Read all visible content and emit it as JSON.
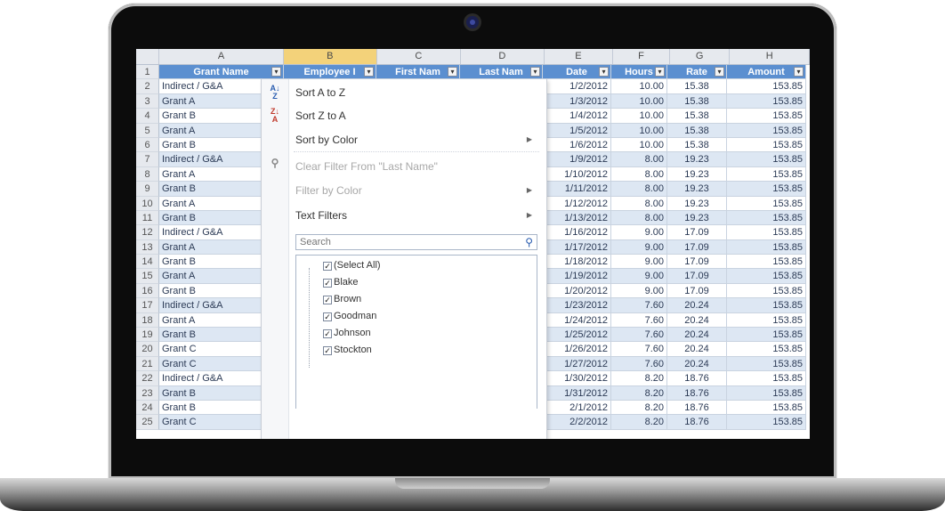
{
  "columns": [
    "A",
    "B",
    "C",
    "D",
    "E",
    "F",
    "G",
    "H"
  ],
  "headers": [
    "Grant Name",
    "Employee I",
    "First Nam",
    "Last Nam",
    "Date",
    "Hours",
    "Rate",
    "Amount"
  ],
  "row_numbers": [
    "1",
    "2",
    "3",
    "4",
    "5",
    "6",
    "7",
    "8",
    "9",
    "10",
    "11",
    "12",
    "13",
    "14",
    "15",
    "16",
    "17",
    "18",
    "19",
    "20",
    "21",
    "22",
    "23",
    "24",
    "25"
  ],
  "rows": [
    {
      "grant": "Indirect / G&A",
      "date": "1/2/2012",
      "hours": "10.00",
      "rate": "15.38",
      "amount": "153.85"
    },
    {
      "grant": "Grant A",
      "date": "1/3/2012",
      "hours": "10.00",
      "rate": "15.38",
      "amount": "153.85"
    },
    {
      "grant": "Grant B",
      "date": "1/4/2012",
      "hours": "10.00",
      "rate": "15.38",
      "amount": "153.85"
    },
    {
      "grant": "Grant A",
      "date": "1/5/2012",
      "hours": "10.00",
      "rate": "15.38",
      "amount": "153.85"
    },
    {
      "grant": "Grant B",
      "date": "1/6/2012",
      "hours": "10.00",
      "rate": "15.38",
      "amount": "153.85"
    },
    {
      "grant": "Indirect / G&A",
      "date": "1/9/2012",
      "hours": "8.00",
      "rate": "19.23",
      "amount": "153.85"
    },
    {
      "grant": "Grant A",
      "date": "1/10/2012",
      "hours": "8.00",
      "rate": "19.23",
      "amount": "153.85"
    },
    {
      "grant": "Grant B",
      "date": "1/11/2012",
      "hours": "8.00",
      "rate": "19.23",
      "amount": "153.85"
    },
    {
      "grant": "Grant A",
      "date": "1/12/2012",
      "hours": "8.00",
      "rate": "19.23",
      "amount": "153.85"
    },
    {
      "grant": "Grant B",
      "date": "1/13/2012",
      "hours": "8.00",
      "rate": "19.23",
      "amount": "153.85"
    },
    {
      "grant": "Indirect / G&A",
      "date": "1/16/2012",
      "hours": "9.00",
      "rate": "17.09",
      "amount": "153.85"
    },
    {
      "grant": "Grant A",
      "date": "1/17/2012",
      "hours": "9.00",
      "rate": "17.09",
      "amount": "153.85"
    },
    {
      "grant": "Grant B",
      "date": "1/18/2012",
      "hours": "9.00",
      "rate": "17.09",
      "amount": "153.85"
    },
    {
      "grant": "Grant A",
      "date": "1/19/2012",
      "hours": "9.00",
      "rate": "17.09",
      "amount": "153.85"
    },
    {
      "grant": "Grant B",
      "date": "1/20/2012",
      "hours": "9.00",
      "rate": "17.09",
      "amount": "153.85"
    },
    {
      "grant": "Indirect / G&A",
      "date": "1/23/2012",
      "hours": "7.60",
      "rate": "20.24",
      "amount": "153.85"
    },
    {
      "grant": "Grant A",
      "date": "1/24/2012",
      "hours": "7.60",
      "rate": "20.24",
      "amount": "153.85"
    },
    {
      "grant": "Grant B",
      "date": "1/25/2012",
      "hours": "7.60",
      "rate": "20.24",
      "amount": "153.85"
    },
    {
      "grant": "Grant C",
      "date": "1/26/2012",
      "hours": "7.60",
      "rate": "20.24",
      "amount": "153.85"
    },
    {
      "grant": "Grant C",
      "date": "1/27/2012",
      "hours": "7.60",
      "rate": "20.24",
      "amount": "153.85"
    },
    {
      "grant": "Indirect / G&A",
      "date": "1/30/2012",
      "hours": "8.20",
      "rate": "18.76",
      "amount": "153.85"
    },
    {
      "grant": "Grant B",
      "date": "1/31/2012",
      "hours": "8.20",
      "rate": "18.76",
      "amount": "153.85"
    },
    {
      "grant": "Grant B",
      "date": "2/1/2012",
      "hours": "8.20",
      "rate": "18.76",
      "amount": "153.85"
    },
    {
      "grant": "Grant C",
      "date": "2/2/2012",
      "hours": "8.20",
      "rate": "18.76",
      "amount": "153.85"
    }
  ],
  "filter_menu": {
    "sort_az": "Sort A to Z",
    "sort_za": "Sort Z to A",
    "sort_by_color": "Sort by Color",
    "clear_filter": "Clear Filter From \"Last Name\"",
    "filter_by_color": "Filter by Color",
    "text_filters": "Text Filters",
    "search_placeholder": "Search",
    "values": [
      "(Select All)",
      "Blake",
      "Brown",
      "Goodman",
      "Johnson",
      "Stockton"
    ]
  },
  "colors": {
    "header_fill": "#5b8fd0",
    "band_fill": "#dde7f3",
    "selected_column": "#f3d27a"
  }
}
